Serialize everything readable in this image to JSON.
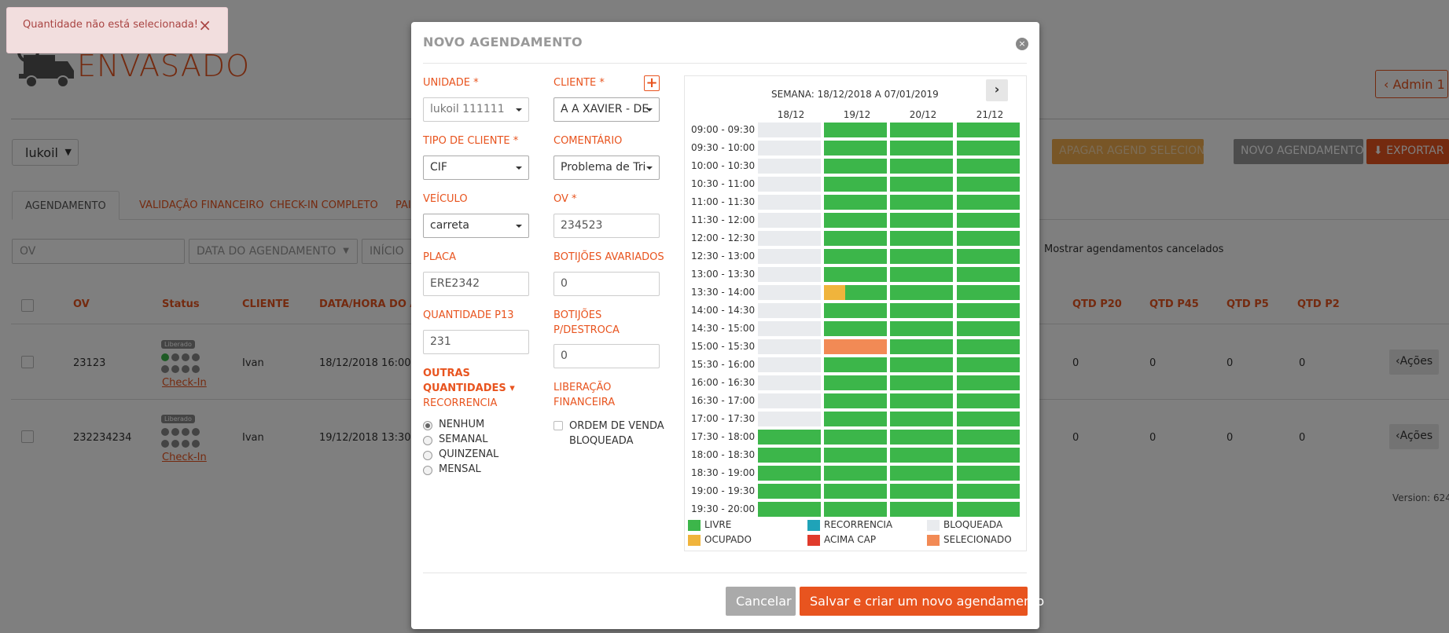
{
  "brand": "ENVASADO",
  "admin_label": "Admin 1",
  "unit_select": "lukoil",
  "toolbar": {
    "delete_selected": "APAGAR AGEND SELECIONADOS",
    "new_schedule": "NOVO AGENDAMENTO",
    "export": "EXPORTAR"
  },
  "tabs": [
    "AGENDAMENTO",
    "VALIDAÇÃO FINANCEIRO",
    "CHECK-IN COMPLETO",
    "PAI"
  ],
  "filters": {
    "ov_placeholder": "OV",
    "date_placeholder": "DATA DO AGENDAMENTO",
    "start_placeholder": "INÍCIO",
    "show_cancelled": "Mostrar agendamentos cancelados"
  },
  "table": {
    "headers": {
      "ov": "OV",
      "status": "Status",
      "cliente": "CLIENTE",
      "data": "DATA/HORA DO AG",
      "p20": "QTD P20",
      "p45": "QTD P45",
      "p5": "QTD P5",
      "p2": "QTD P2"
    },
    "rows": [
      {
        "ov": "23123",
        "badge": "Liberado",
        "checkin": "Check-In",
        "cliente": "Ivan",
        "data": "18/12/2018 16:00",
        "p20": "0",
        "p45": "0",
        "p5": "0",
        "p2": "0",
        "acoes": "Ações"
      },
      {
        "ov": "232234234",
        "badge": "Liberado",
        "checkin": "Check-In",
        "cliente": "Ivan",
        "data": "19/12/2018 13:30",
        "p20": "0",
        "p45": "0",
        "p5": "0",
        "p2": "0",
        "acoes": "Ações"
      }
    ]
  },
  "version": "Version: 624",
  "toast": {
    "message": "Quantidade não está selecionada!",
    "close": "×"
  },
  "modal": {
    "title": "NOVO AGENDAMENTO",
    "close": "×",
    "unidade": {
      "label": "UNIDADE *",
      "value": "lukoil 111111"
    },
    "cliente": {
      "label": "CLIENTE *",
      "value": "A A XAVIER - DE",
      "add": "+"
    },
    "tipo_cliente": {
      "label": "TIPO DE CLIENTE *",
      "value": "CIF"
    },
    "comentario": {
      "label": "COMENTÁRIO",
      "value": "Problema de Tri"
    },
    "veiculo": {
      "label": "VEÍCULO",
      "value": "carreta"
    },
    "ov": {
      "label": "OV *",
      "value": "234523"
    },
    "placa": {
      "label": "PLACA",
      "value": "ERE2342"
    },
    "avariados": {
      "label": "BOTIJÕES AVARIADOS",
      "value": "0"
    },
    "qtd_p13": {
      "label": "QUANTIDADE P13",
      "value": "231"
    },
    "destroca": {
      "label_1": "BOTIJÕES",
      "label_2": "P/DESTROCA",
      "value": "0"
    },
    "outras": {
      "line1": "OUTRAS",
      "line2": "QUANTIDADES ▾"
    },
    "recorrencia": {
      "label": "RECORRENCIA",
      "options": [
        "NENHUM",
        "SEMANAL",
        "QUINZENAL",
        "MENSAL"
      ],
      "selected": "NENHUM"
    },
    "liberacao": {
      "label_1": "LIBERAÇÃO",
      "label_2": "FINANCEIRA",
      "checkbox_1": "ORDEM DE VENDA",
      "checkbox_2": "BLOQUEADA"
    },
    "calendar": {
      "week": "SEMANA: 18/12/2018 A 07/01/2019",
      "next": "›",
      "days": [
        "18/12",
        "19/12",
        "20/12",
        "21/12"
      ],
      "slots": [
        "09:00 - 09:30",
        "09:30 - 10:00",
        "10:00 - 10:30",
        "10:30 - 11:00",
        "11:00 - 11:30",
        "11:30 - 12:00",
        "12:00 - 12:30",
        "12:30 - 13:00",
        "13:00 - 13:30",
        "13:30 - 14:00",
        "14:00 - 14:30",
        "14:30 - 15:00",
        "15:00 - 15:30",
        "15:30 - 16:00",
        "16:00 - 16:30",
        "16:30 - 17:00",
        "17:00 - 17:30",
        "17:30 - 18:00",
        "18:00 - 18:30",
        "18:30 - 19:00",
        "19:00 - 19:30",
        "19:30 - 20:00"
      ],
      "legend": [
        {
          "label": "LIVRE",
          "color": "#3cb64a"
        },
        {
          "label": "RECORRENCIA",
          "color": "#1fa3b8"
        },
        {
          "label": "BLOQUEADA",
          "color": "#e9ebee"
        },
        {
          "label": "OCUPADO",
          "color": "#f0b43c"
        },
        {
          "label": "ACIMA CAP",
          "color": "#e03b2c"
        },
        {
          "label": "SELECIONADO",
          "color": "#f28a55"
        }
      ]
    },
    "cancel": "Cancelar",
    "save": "Salvar e criar um novo agendamento"
  }
}
